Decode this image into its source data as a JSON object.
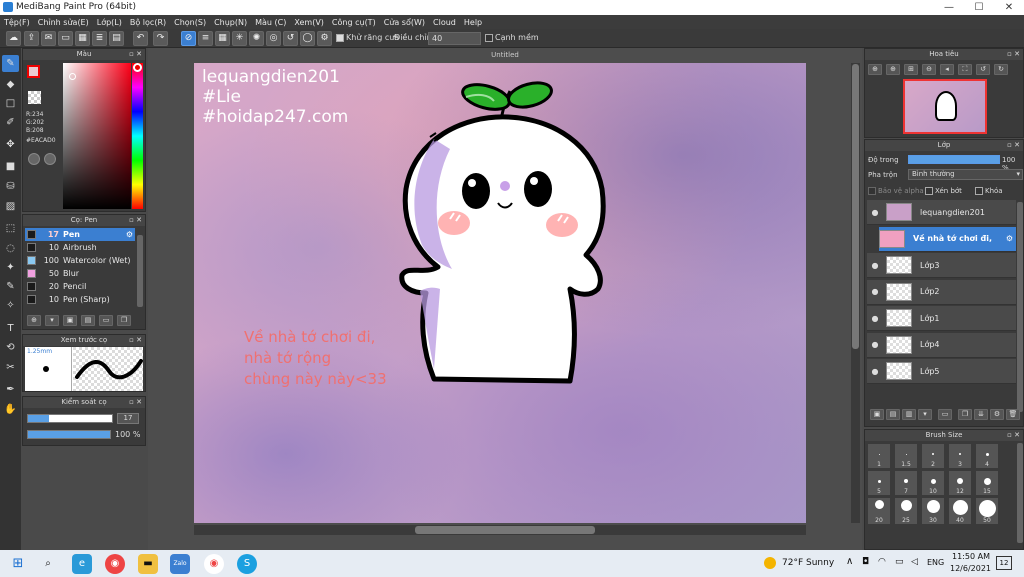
{
  "window": {
    "title": "MediBang Paint Pro (64bit)",
    "minimize": "—",
    "maximize": "☐",
    "close": "✕"
  },
  "menu": [
    "Tệp(F)",
    "Chỉnh sửa(E)",
    "Lớp(L)",
    "Bộ lọc(R)",
    "Chọn(S)",
    "Chụp(N)",
    "Màu (C)",
    "Xem(V)",
    "Công cụ(T)",
    "Cửa sổ(W)",
    "Cloud",
    "Help"
  ],
  "toolbar": {
    "antialias_label": "Khử răng cưa",
    "adjust_label": "Điều chỉnh",
    "adjust_value": "40",
    "smooth_label": "Cạnh mềm"
  },
  "color_panel": {
    "title": "Màu",
    "r": "R:234",
    "g": "G:202",
    "b": "B:208",
    "hex": "#EACAD0",
    "fg_color": "#EACAD0"
  },
  "brush_panel": {
    "title": "Cọ: Pen",
    "items": [
      {
        "size": "17",
        "name": "Pen",
        "color": "#1a1a1a"
      },
      {
        "size": "10",
        "name": "Airbrush",
        "color": "#1a1a1a"
      },
      {
        "size": "100",
        "name": "Watercolor (Wet)",
        "color": "#8ac8f0"
      },
      {
        "size": "50",
        "name": "Blur",
        "color": "#f0a0e0"
      },
      {
        "size": "20",
        "name": "Pencil",
        "color": "#1a1a1a"
      },
      {
        "size": "10",
        "name": "Pen (Sharp)",
        "color": "#1a1a1a"
      }
    ]
  },
  "preview_panel": {
    "title": "Xem trước cọ",
    "size": "1.25mm"
  },
  "control_panel": {
    "title": "Kiểm soát cọ",
    "size_value": "17",
    "size_fill": 0.25,
    "opacity_value": "100 %",
    "opacity_fill": 1.0
  },
  "document": {
    "title": "Untitled"
  },
  "canvas_text": {
    "watermark": [
      "lequangdien201",
      "#Lie",
      "#hoidap247.com"
    ],
    "message": [
      "Về nhà tớ chơi đi,",
      "nhà tớ rộng",
      "chùng này này<33"
    ]
  },
  "navigator": {
    "title": "Hoa tiêu"
  },
  "layer_panel": {
    "title": "Lớp",
    "opacity_label": "Độ trong",
    "opacity_value": "100 %",
    "opacity_fill": 1.0,
    "blend_label": "Pha trộn",
    "blend_value": "Bình thường",
    "protect_alpha": "Bảo vệ alpha",
    "clipping": "Xén bớt",
    "lock": "Khóa",
    "layers": [
      {
        "name": "lequangdien201"
      },
      {
        "name": "Về nhà tớ chơi đi,"
      },
      {
        "name": "Lớp3"
      },
      {
        "name": "Lớp2"
      },
      {
        "name": "Lớp1"
      },
      {
        "name": "Lớp4"
      },
      {
        "name": "Lớp5"
      }
    ]
  },
  "brush_size_panel": {
    "title": "Brush Size",
    "row1": [
      "1",
      "1.5",
      "2",
      "3",
      "4"
    ],
    "row2": [
      "5",
      "7",
      "10",
      "12",
      "15"
    ],
    "row3": [
      "20",
      "25",
      "30",
      "40",
      "50"
    ]
  },
  "taskbar": {
    "weather": "72°F  Sunny",
    "lang": "ENG",
    "time": "11:50 AM",
    "date": "12/6/2021",
    "notif": "12"
  }
}
